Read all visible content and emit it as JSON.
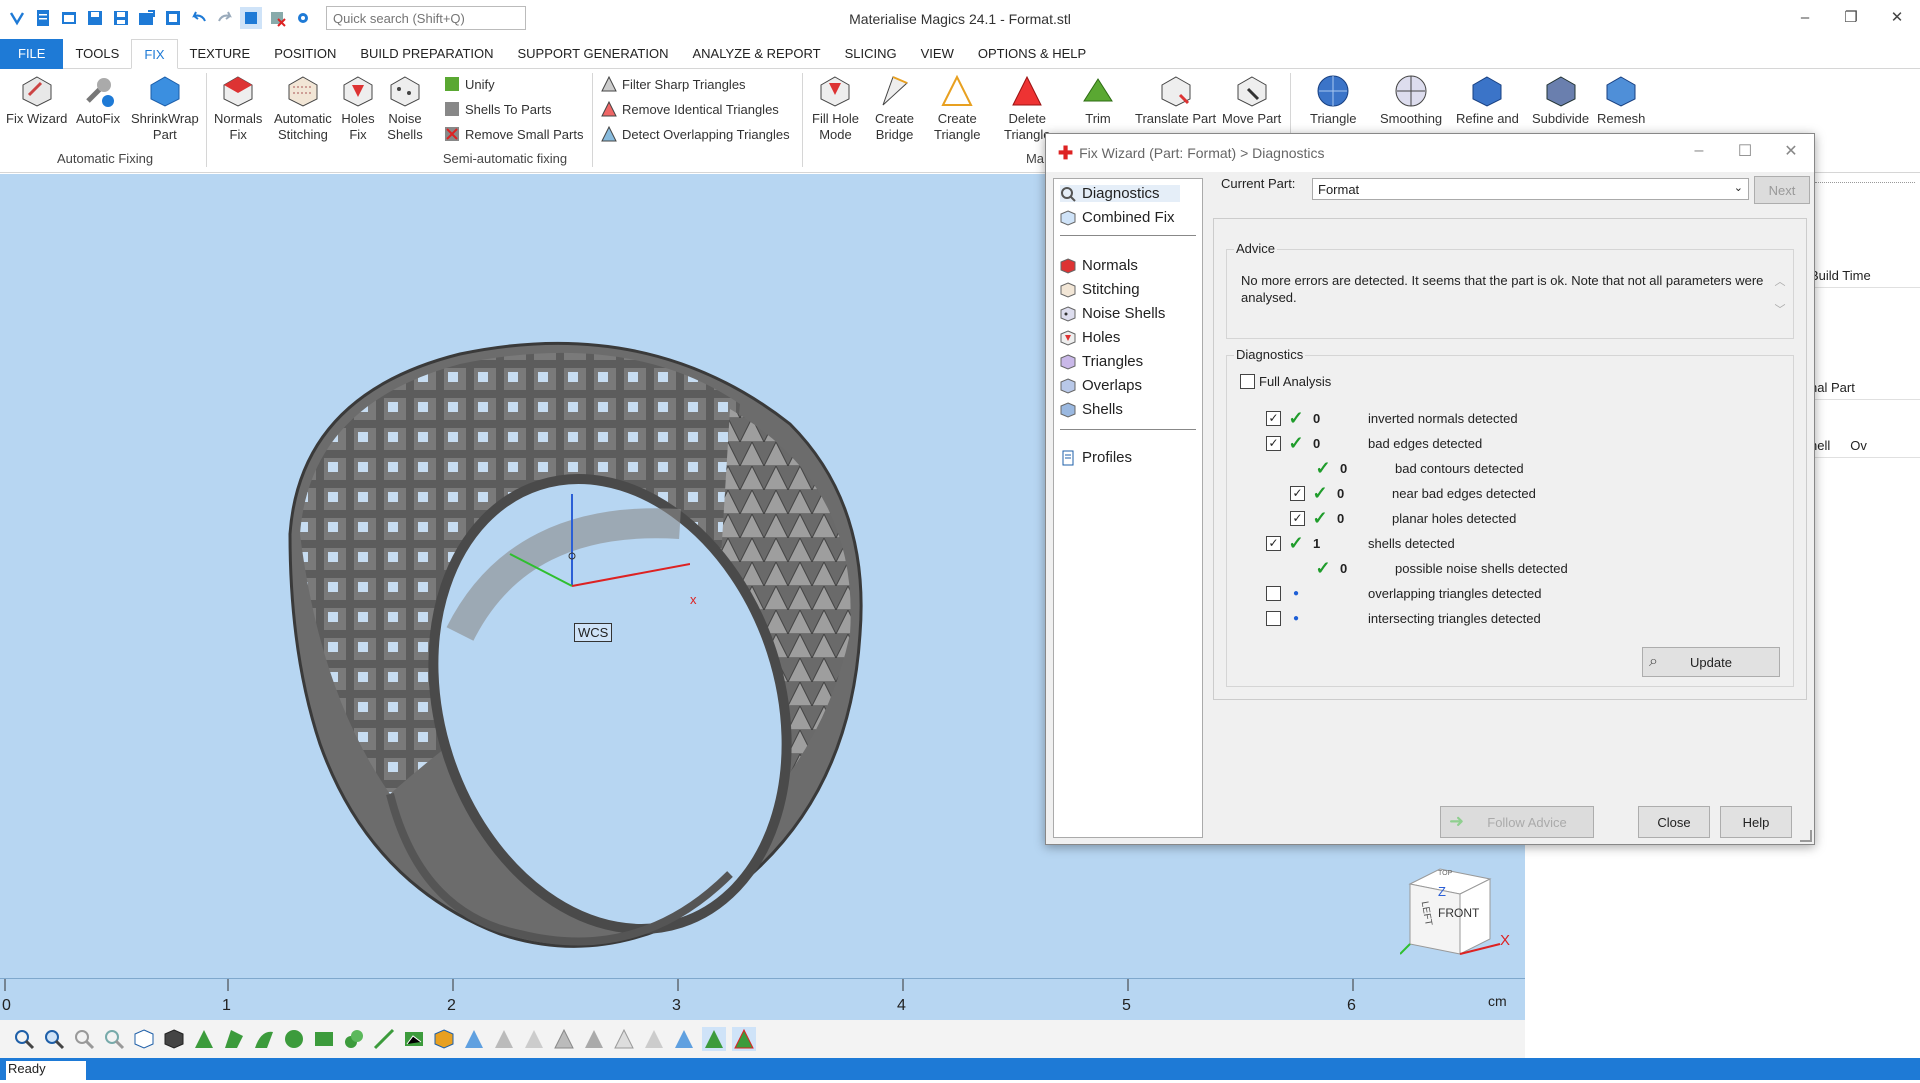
{
  "app": {
    "title": "Materialise Magics 24.1 - Format.stl"
  },
  "search": {
    "placeholder": "Quick search (Shift+Q)"
  },
  "menu": {
    "tabs": [
      "FILE",
      "TOOLS",
      "FIX",
      "TEXTURE",
      "POSITION",
      "BUILD PREPARATION",
      "SUPPORT GENERATION",
      "ANALYZE & REPORT",
      "SLICING",
      "VIEW",
      "OPTIONS & HELP"
    ],
    "active": "FIX"
  },
  "ribbon": {
    "fix_wizard": "Fix Wizard",
    "autofix": "AutoFix",
    "shrinkwrap_1": "ShrinkWrap",
    "shrinkwrap_2": "Part",
    "group_auto": "Automatic Fixing",
    "normals_1": "Normals",
    "normals_2": "Fix",
    "stitching_1": "Automatic",
    "stitching_2": "Stitching",
    "holes_1": "Holes",
    "holes_2": "Fix",
    "noise_1": "Noise",
    "noise_2": "Shells",
    "unify": "Unify",
    "shells_to_parts": "Shells To Parts",
    "remove_small": "Remove Small Parts",
    "group_semi": "Semi-automatic fixing",
    "filter_sharp": "Filter Sharp Triangles",
    "remove_identical": "Remove Identical Triangles",
    "detect_overlap": "Detect Overlapping Triangles",
    "fill_hole_1": "Fill Hole",
    "fill_hole_2": "Mode",
    "create_bridge_1": "Create",
    "create_bridge_2": "Bridge",
    "create_tri_1": "Create",
    "create_tri_2": "Triangle",
    "delete_tri_1": "Delete",
    "delete_tri_2": "Triangle",
    "trim": "Trim",
    "translate": "Translate Part",
    "move_part": "Move Part",
    "group_ma": "Ma",
    "triangle": "Triangle",
    "smoothing": "Smoothing",
    "refine": "Refine and",
    "subdivide": "Subdivide",
    "remesh": "Remesh"
  },
  "viewport": {
    "wcs_label": "WCS",
    "axis_x": "x",
    "cube_top": "TOP",
    "cube_front": "FRONT",
    "cube_left": "LEFT",
    "cube_z": "Z",
    "cube_x": "X"
  },
  "ruler": {
    "ticks": [
      "0",
      "1",
      "2",
      "3",
      "4",
      "5",
      "6"
    ],
    "unit": "cm"
  },
  "status": {
    "text": "Ready"
  },
  "right_panel": {
    "build_time": "Build Time",
    "nal_part": "nal Part",
    "hell": "hell",
    "ov": "Ov"
  },
  "dialog": {
    "title": "Fix Wizard (Part: Format) > Diagnostics",
    "nav": {
      "diagnostics": "Diagnostics",
      "combined_fix": "Combined Fix",
      "normals": "Normals",
      "stitching": "Stitching",
      "noise_shells": "Noise Shells",
      "holes": "Holes",
      "triangles": "Triangles",
      "overlaps": "Overlaps",
      "shells": "Shells",
      "profiles": "Profiles"
    },
    "current_part_label": "Current Part:",
    "current_part_value": "Format",
    "next_label": "Next",
    "advice_label": "Advice",
    "advice_text": "No more errors are detected. It seems that the part is ok. Note that not all parameters were analysed.",
    "diagnostics_label": "Diagnostics",
    "full_analysis": "Full Analysis",
    "rows": [
      {
        "count": "0",
        "text": "inverted normals detected"
      },
      {
        "count": "0",
        "text": "bad edges detected"
      },
      {
        "count": "0",
        "text": "bad contours detected"
      },
      {
        "count": "0",
        "text": "near bad edges detected"
      },
      {
        "count": "0",
        "text": "planar holes detected"
      },
      {
        "count": "1",
        "text": "shells detected"
      },
      {
        "count": "0",
        "text": "possible noise shells detected"
      },
      {
        "count": "",
        "text": "overlapping triangles detected"
      },
      {
        "count": "",
        "text": "intersecting triangles detected"
      }
    ],
    "update_label": "Update",
    "follow_advice": "Follow Advice",
    "close_label": "Close",
    "help_label": "Help"
  },
  "colors": {
    "accent": "#1e7ad6",
    "viewport_bg": "#b7d6f2",
    "check": "#1f9c2b"
  }
}
